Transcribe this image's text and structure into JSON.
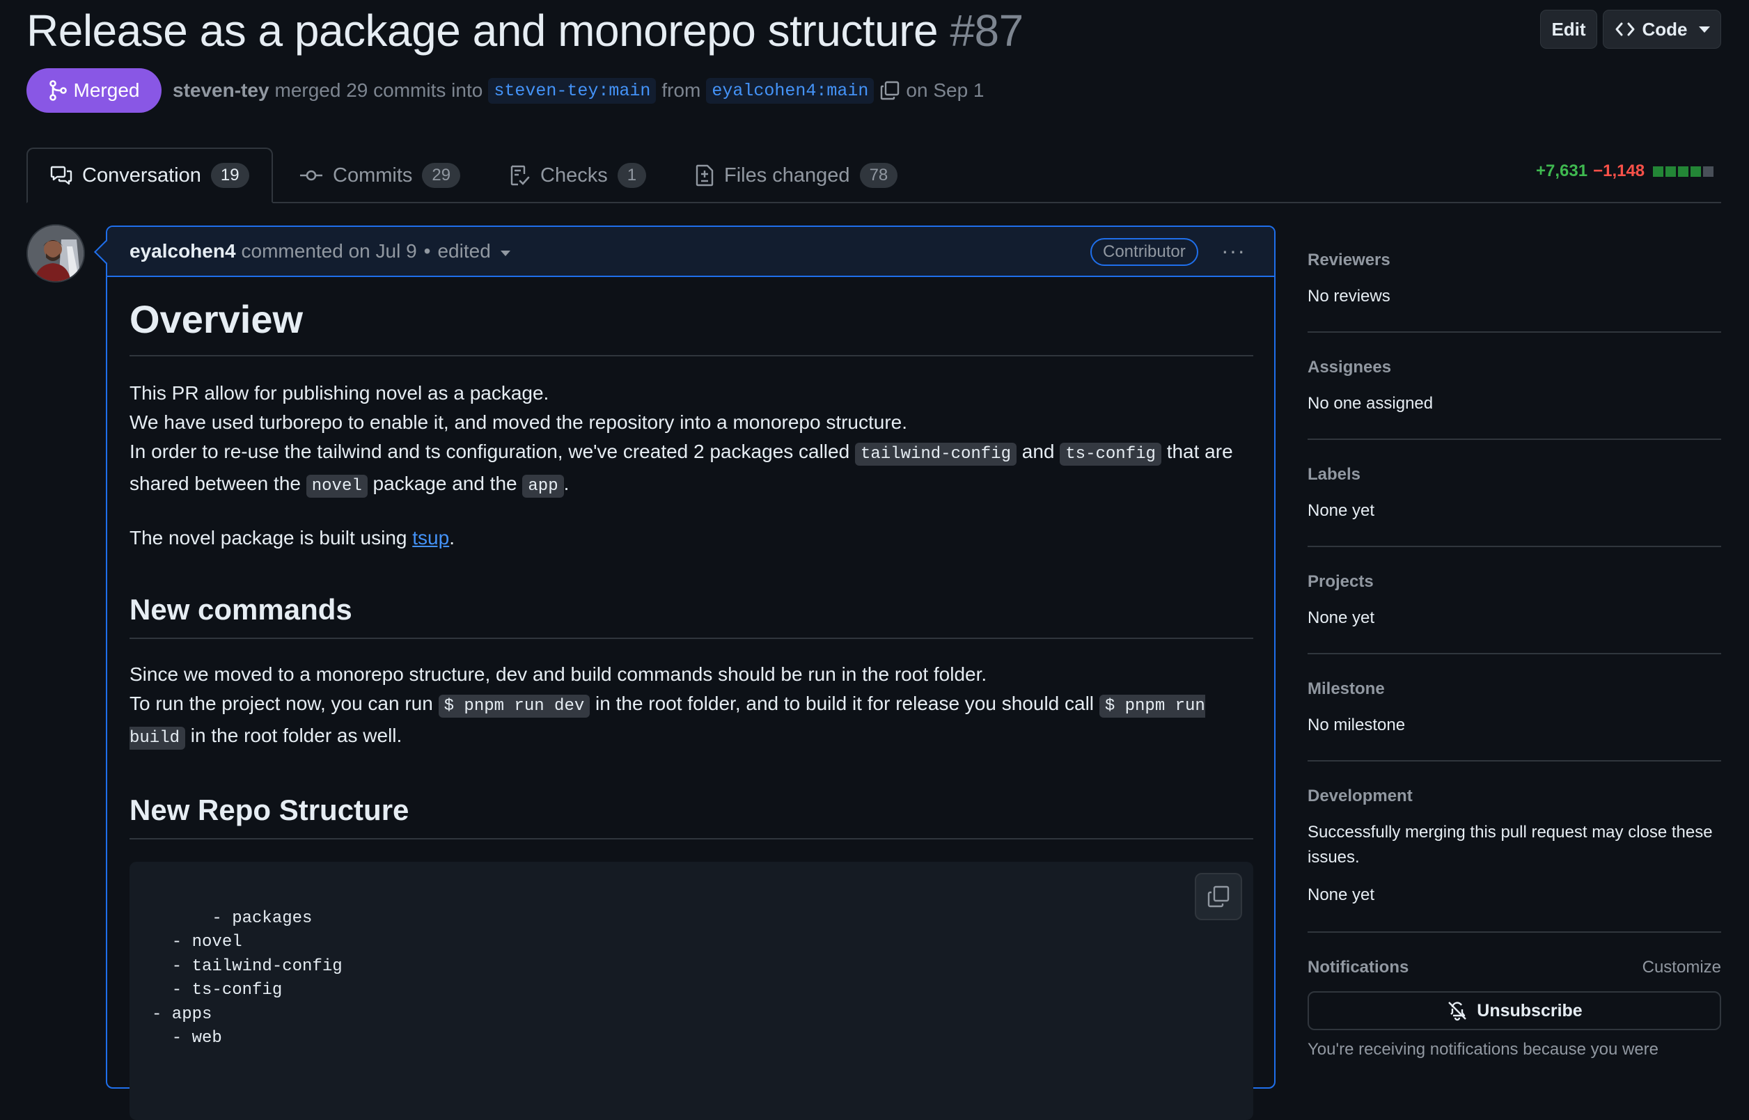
{
  "pr": {
    "title": "Release as a package and monorepo structure",
    "number": "#87",
    "edit_label": "Edit",
    "code_label": "Code",
    "status": "Merged",
    "merger": "steven-tey",
    "merged_text": "merged 29 commits into",
    "base_branch": "steven-tey:main",
    "from_text": "from",
    "head_branch": "eyalcohen4:main",
    "date_text": "on Sep 1"
  },
  "tabs": [
    {
      "label": "Conversation",
      "count": "19",
      "icon": "comment-discussion-icon"
    },
    {
      "label": "Commits",
      "count": "29",
      "icon": "git-commit-icon"
    },
    {
      "label": "Checks",
      "count": "1",
      "icon": "checklist-icon"
    },
    {
      "label": "Files changed",
      "count": "78",
      "icon": "file-diff-icon"
    }
  ],
  "diffstat": {
    "additions": "+7,631",
    "deletions": "−1,148",
    "green_squares": 4,
    "gray_squares": 1
  },
  "comment": {
    "author": "eyalcohen4",
    "action": "commented on Jul 9",
    "bullet": "•",
    "edited": "edited",
    "badge": "Contributor",
    "menu": "···",
    "h_overview": "Overview",
    "p1_line1": "This PR allow for publishing novel as a package.",
    "p1_line2": "We have used turborepo to enable it, and moved the repository into a monorepo structure.",
    "p1_line3a": "In order to re-use the tailwind and ts configuration, we've created 2 packages called",
    "code_tailwind": "tailwind-config",
    "and": "and",
    "code_ts": "ts-config",
    "p1_line3b": "that are shared between the",
    "code_novel": "novel",
    "p1_line3c": "package and the",
    "code_app": "app",
    "p2_a": "The novel package is built using",
    "tsup": "tsup",
    "h_commands": "New commands",
    "p3_line1": "Since we moved to a monorepo structure, dev and build commands should be run in the root folder.",
    "p3_a": "To run the project now, you can run",
    "code_dev": "$ pnpm run dev",
    "p3_b": "in the root folder, and to build it for release you should call",
    "code_build": "$ pnpm run build",
    "p3_c": "in the root folder as well.",
    "h_structure": "New Repo Structure",
    "code_block": "- packages\n  - novel\n  - tailwind-config\n  - ts-config\n- apps\n  - web"
  },
  "sidebar": {
    "reviewers": {
      "heading": "Reviewers",
      "value": "No reviews"
    },
    "assignees": {
      "heading": "Assignees",
      "value": "No one assigned"
    },
    "labels": {
      "heading": "Labels",
      "value": "None yet"
    },
    "projects": {
      "heading": "Projects",
      "value": "None yet"
    },
    "milestone": {
      "heading": "Milestone",
      "value": "No milestone"
    },
    "development": {
      "heading": "Development",
      "text": "Successfully merging this pull request may close these issues.",
      "value": "None yet"
    },
    "notifications": {
      "heading": "Notifications",
      "customize": "Customize",
      "unsubscribe": "Unsubscribe",
      "reason": "You're receiving notifications because you were"
    }
  },
  "colors": {
    "merged": "#8957e5",
    "link": "#4493f8",
    "additions": "#3fb950",
    "deletions": "#f85149",
    "background": "#0d1117"
  }
}
